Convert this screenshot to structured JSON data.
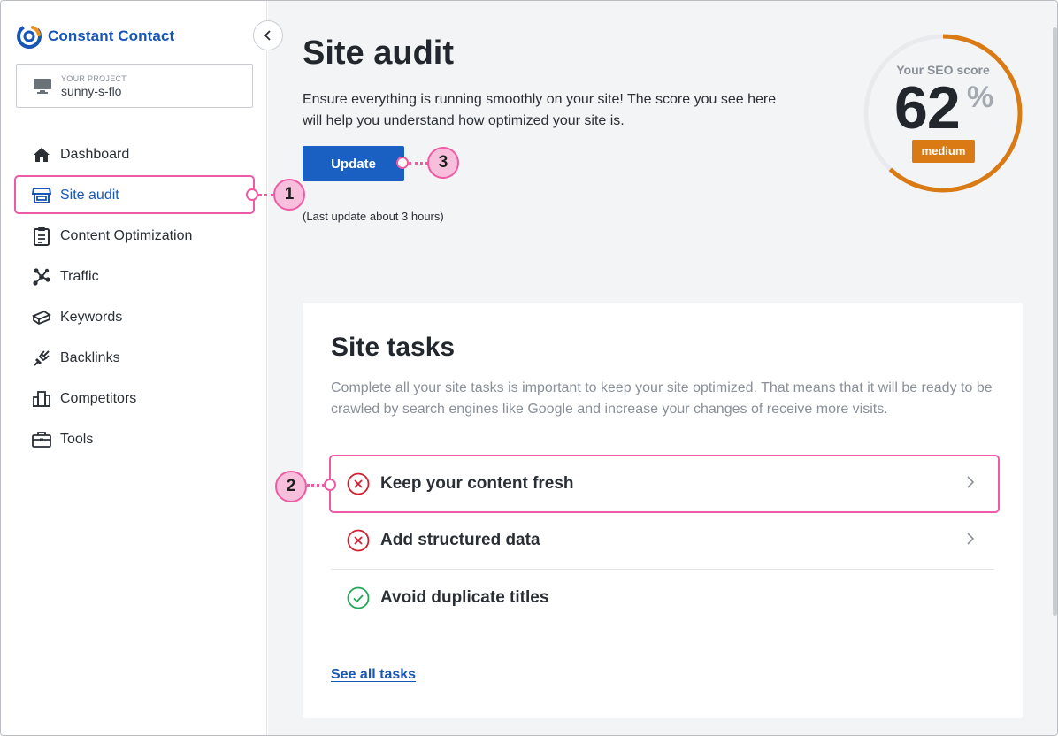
{
  "brand": {
    "name": "Constant Contact",
    "color": "#1856b6"
  },
  "project": {
    "label": "YOUR PROJECT",
    "name": "sunny-s-flo"
  },
  "sidebar": {
    "items": [
      {
        "label": "Dashboard",
        "icon": "home-icon"
      },
      {
        "label": "Site audit",
        "icon": "storefront-icon",
        "active": true
      },
      {
        "label": "Content Optimization",
        "icon": "clipboard-icon"
      },
      {
        "label": "Traffic",
        "icon": "network-icon"
      },
      {
        "label": "Keywords",
        "icon": "keywords-icon"
      },
      {
        "label": "Backlinks",
        "icon": "link-plug-icon"
      },
      {
        "label": "Competitors",
        "icon": "buildings-icon"
      },
      {
        "label": "Tools",
        "icon": "toolbox-icon"
      }
    ]
  },
  "header": {
    "title": "Site audit",
    "intro": "Ensure everything is running smoothly on your site! The score you see here will help you understand how optimized your site is.",
    "update_label": "Update",
    "last_update": "(Last update about 3 hours)"
  },
  "score": {
    "label": "Your SEO score",
    "value": "62",
    "unit": "%",
    "level": "medium",
    "fraction": 0.62,
    "color": "#d97a14"
  },
  "tasks_card": {
    "title": "Site tasks",
    "description": "Complete all your site tasks is important to keep your site optimized. That means that it will be ready to be crawled by search engines like Google and increase your changes of receive more visits.",
    "tasks": [
      {
        "label": "Keep your content fresh",
        "status": "error",
        "icon": "x-circle-icon"
      },
      {
        "label": "Add structured data",
        "status": "error",
        "icon": "x-circle-icon"
      },
      {
        "label": "Avoid duplicate titles",
        "status": "ok",
        "icon": "check-circle-icon"
      }
    ],
    "see_all_label": "See all tasks"
  },
  "callouts": [
    "1",
    "2",
    "3"
  ],
  "colors": {
    "accent": "#1a5fc2",
    "highlight": "#ee5ba4",
    "error": "#d0202f",
    "success": "#21a657"
  }
}
